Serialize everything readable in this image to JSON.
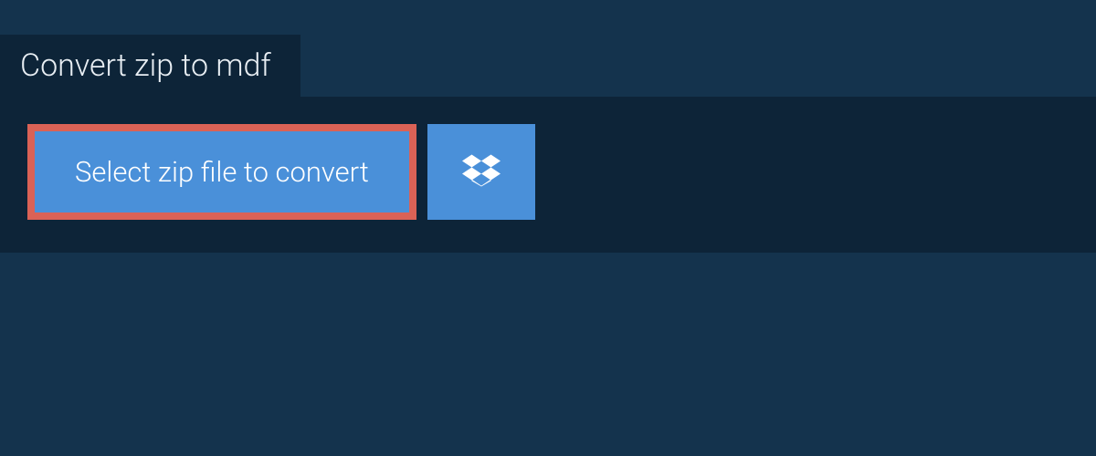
{
  "tab": {
    "label": "Convert zip to mdf"
  },
  "actions": {
    "select_file_label": "Select zip file to convert"
  }
}
